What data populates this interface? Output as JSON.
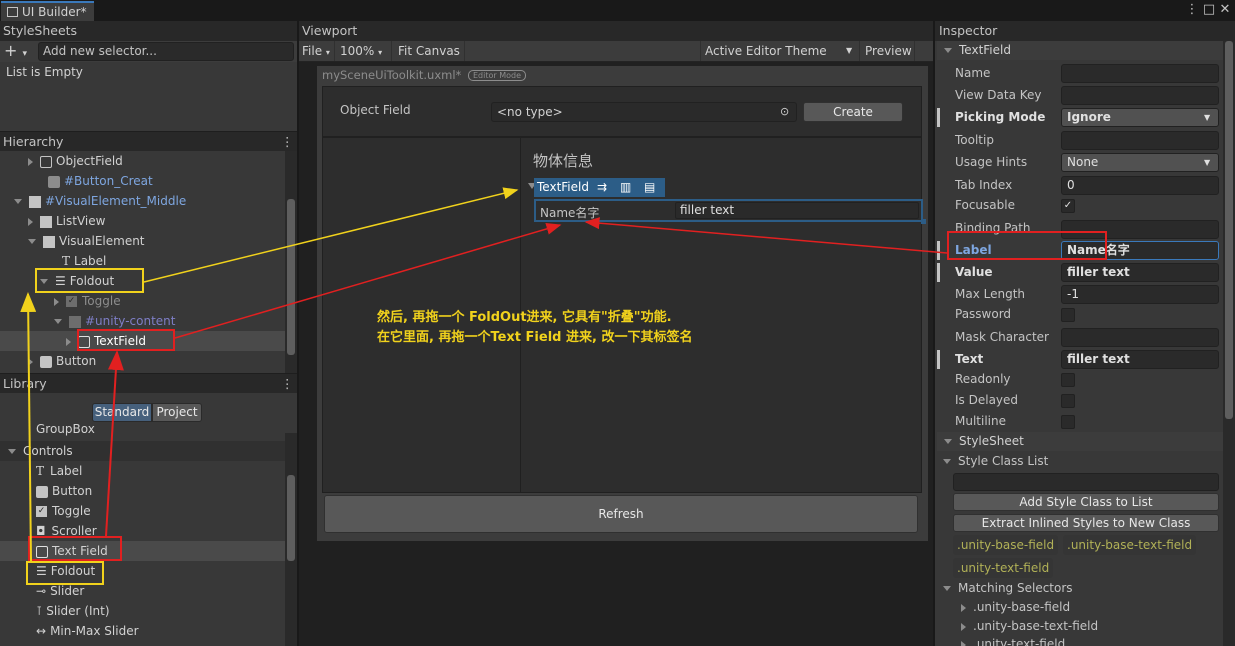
{
  "window": {
    "tab_title": "UI Builder*"
  },
  "stylesheets": {
    "header": "StyleSheets",
    "add_selector_placeholder": "Add new selector...",
    "empty_text": "List is Empty"
  },
  "hierarchy": {
    "header": "Hierarchy",
    "items": [
      {
        "label": "ObjectField",
        "icon": "object-field-icon"
      },
      {
        "label": "#Button_Creat",
        "icon": "button-icon"
      },
      {
        "label": "#VisualElement_Middle",
        "icon": "visual-element-icon"
      },
      {
        "label": "ListView",
        "icon": "list-view-icon"
      },
      {
        "label": "VisualElement",
        "icon": "visual-element-icon"
      },
      {
        "label": "Label",
        "icon": "label-icon"
      },
      {
        "label": "Foldout",
        "icon": "foldout-icon"
      },
      {
        "label": "Toggle",
        "icon": "toggle-icon"
      },
      {
        "label": "#unity-content",
        "icon": "visual-element-icon"
      },
      {
        "label": "TextField",
        "icon": "text-field-icon"
      },
      {
        "label": "Button",
        "icon": "button-icon"
      }
    ]
  },
  "library": {
    "header": "Library",
    "tabs": [
      "Standard",
      "Project"
    ],
    "active_tab": "Standard",
    "group_box": "GroupBox",
    "controls_header": "Controls",
    "items": [
      {
        "label": "Label",
        "icon": "label-icon"
      },
      {
        "label": "Button",
        "icon": "button-icon"
      },
      {
        "label": "Toggle",
        "icon": "toggle-icon"
      },
      {
        "label": "Scroller",
        "icon": "scroller-icon"
      },
      {
        "label": "Text Field",
        "icon": "text-field-icon"
      },
      {
        "label": "Foldout",
        "icon": "foldout-icon"
      },
      {
        "label": "Slider",
        "icon": "slider-icon"
      },
      {
        "label": "Slider (Int)",
        "icon": "slider-int-icon"
      },
      {
        "label": "Min-Max Slider",
        "icon": "min-max-slider-icon"
      }
    ]
  },
  "viewport": {
    "header": "Viewport",
    "file_menu": "File",
    "zoom": "100%",
    "fit_canvas": "Fit Canvas",
    "theme": "Active Editor Theme",
    "preview": "Preview",
    "document_title": "mySceneUiToolkit.uxml*",
    "editor_mode_badge": "Editor Mode",
    "object_field_label": "Object Field",
    "object_field_value": "<no type>",
    "create_button": "Create",
    "section_title": "物体信息",
    "selected_element": "TextField",
    "text_field_label": "Name名字",
    "text_field_value": "filler text",
    "refresh_button": "Refresh",
    "annotation_line1": "然后, 再拖一个 FoldOut进来, 它具有\"折叠\"功能.",
    "annotation_line2": "在它里面, 再拖一个Text Field 进来, 改一下其标签名"
  },
  "inspector": {
    "header": "Inspector",
    "section_textfield": "TextField",
    "fields": {
      "name": {
        "label": "Name",
        "value": ""
      },
      "view_data_key": {
        "label": "View Data Key",
        "value": ""
      },
      "picking_mode": {
        "label": "Picking Mode",
        "value": "Ignore"
      },
      "tooltip": {
        "label": "Tooltip",
        "value": ""
      },
      "usage_hints": {
        "label": "Usage Hints",
        "value": "None"
      },
      "tab_index": {
        "label": "Tab Index",
        "value": "0"
      },
      "focusable": {
        "label": "Focusable",
        "checked": true
      },
      "binding_path": {
        "label": "Binding Path",
        "value": ""
      },
      "label": {
        "label": "Label",
        "value": "Name名字"
      },
      "value": {
        "label": "Value",
        "value": "filler text"
      },
      "max_length": {
        "label": "Max Length",
        "value": "-1"
      },
      "password": {
        "label": "Password",
        "checked": false
      },
      "mask_character": {
        "label": "Mask Character",
        "value": ""
      },
      "text": {
        "label": "Text",
        "value": "filler text"
      },
      "readonly": {
        "label": "Readonly",
        "checked": false
      },
      "is_delayed": {
        "label": "Is Delayed",
        "checked": false
      },
      "multiline": {
        "label": "Multiline",
        "checked": false
      }
    },
    "section_stylesheet": "StyleSheet",
    "style_class_list": "Style Class List",
    "add_style_class": "Add Style Class to List",
    "extract_inlined": "Extract Inlined Styles to New Class",
    "classes": [
      ".unity-base-field",
      ".unity-base-text-field",
      ".unity-text-field"
    ],
    "matching_selectors": "Matching Selectors",
    "selectors": [
      ".unity-base-field",
      ".unity-base-text-field",
      ".unity-text-field"
    ]
  },
  "colors": {
    "selection": "#2c5d87",
    "annotation_yellow": "#f1d21c",
    "annotation_red": "#e12020",
    "accent_blue": "#3a79bb"
  }
}
